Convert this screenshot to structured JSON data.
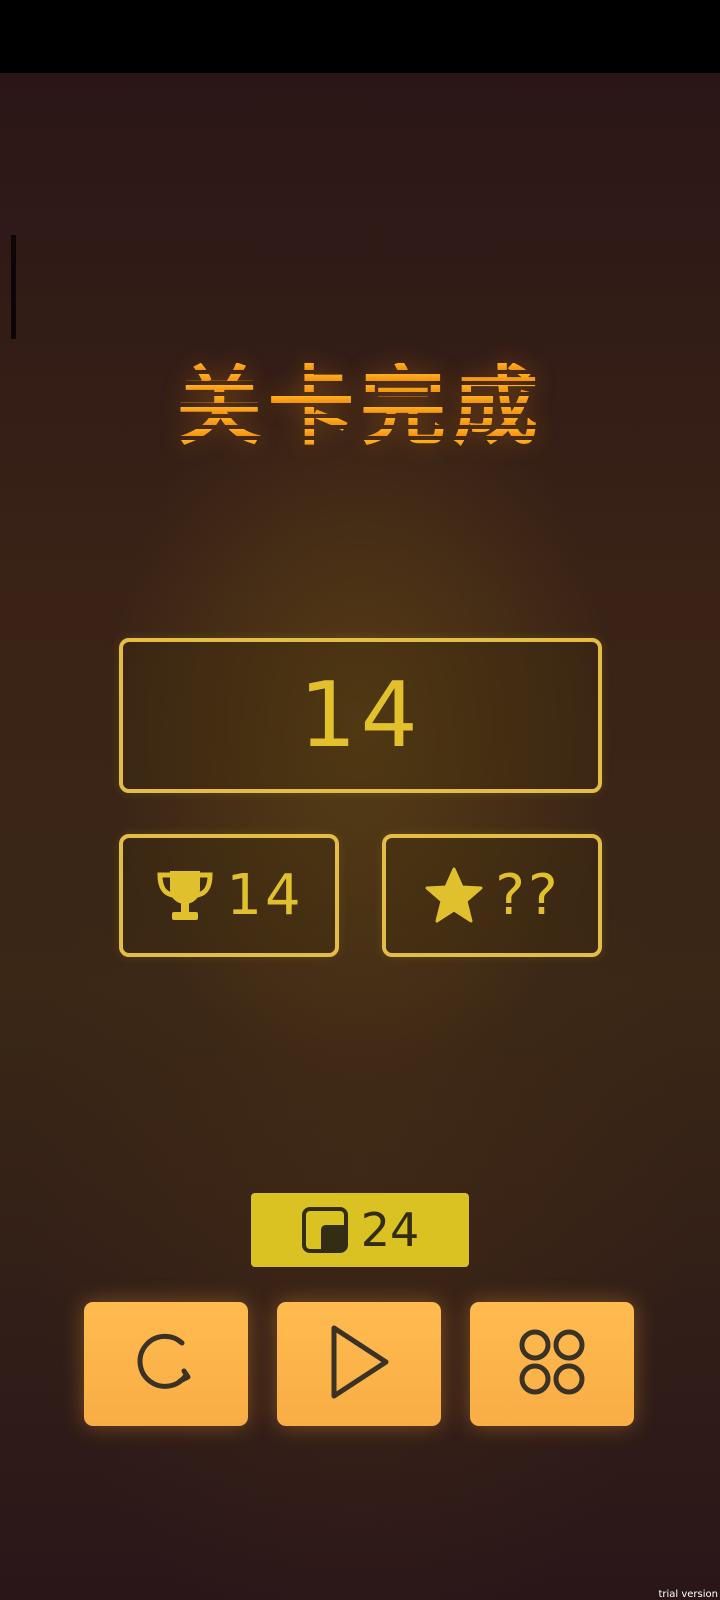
{
  "title": "关卡完成",
  "score": "14",
  "best": {
    "icon": "trophy-icon",
    "value": "14"
  },
  "stars": {
    "icon": "star-icon",
    "value": "??"
  },
  "hints": {
    "icon": "hint-box-icon",
    "count": "24"
  },
  "actions": [
    {
      "icon": "restart-icon"
    },
    {
      "icon": "play-icon"
    },
    {
      "icon": "level-grid-icon"
    }
  ],
  "watermark": "trial version",
  "colors": {
    "accent_gold": "#e0c02c",
    "title_orange": "#f19d16",
    "button_orange": "#fbb148",
    "hint_yellow": "#d9c221",
    "icon_dark": "#3a3225"
  }
}
